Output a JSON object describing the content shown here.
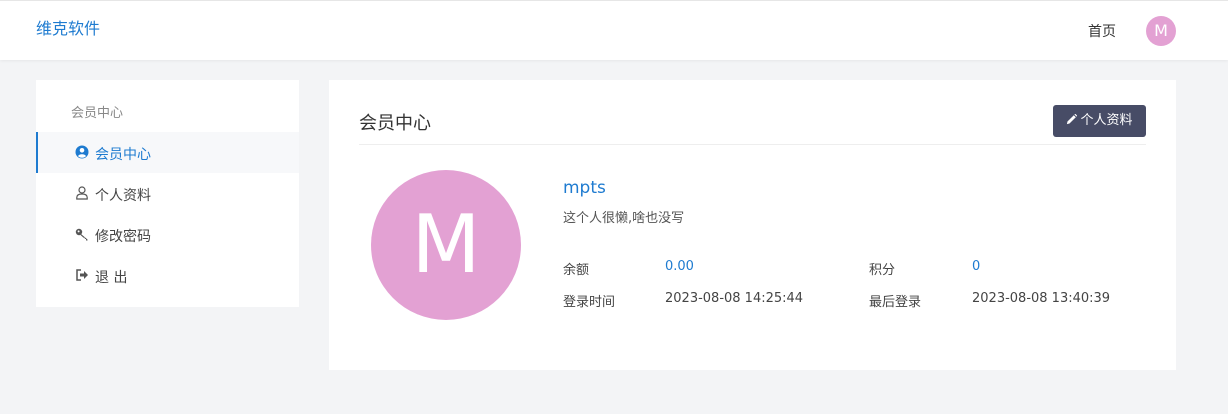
{
  "header": {
    "brand": "维克软件",
    "nav_home": "首页",
    "avatar_letter": "M"
  },
  "sidebar": {
    "title": "会员中心",
    "items": [
      {
        "label": "会员中心",
        "icon": "user-circle-icon",
        "active": true
      },
      {
        "label": "个人资料",
        "icon": "user-icon",
        "active": false
      },
      {
        "label": "修改密码",
        "icon": "key-icon",
        "active": false
      },
      {
        "label": "退 出",
        "icon": "sign-out-icon",
        "active": false
      }
    ]
  },
  "main": {
    "title": "会员中心",
    "edit_button": "个人资料",
    "avatar_letter": "M",
    "username": "mpts",
    "bio": "这个人很懒,啥也没写",
    "stats": {
      "balance_label": "余额",
      "balance_value": "0.00",
      "points_label": "积分",
      "points_value": "0",
      "login_time_label": "登录时间",
      "login_time_value": "2023-08-08 14:25:44",
      "last_login_label": "最后登录",
      "last_login_value": "2023-08-08 13:40:39"
    }
  },
  "colors": {
    "accent": "#1e7bd0",
    "avatar": "#e3a1d3",
    "button": "#474c66",
    "background": "#f3f4f6"
  }
}
